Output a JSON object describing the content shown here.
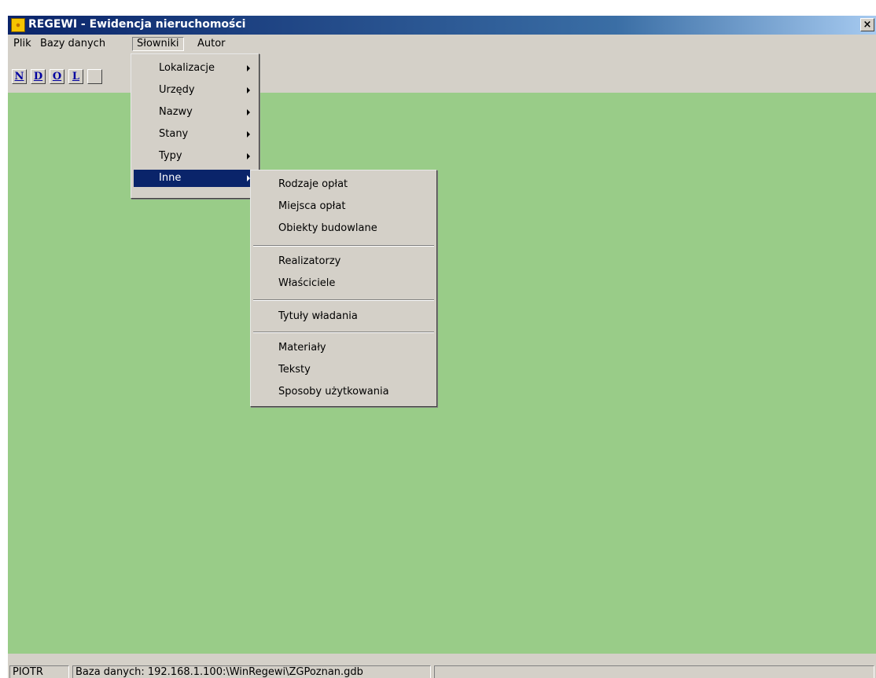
{
  "window": {
    "title": "REGEWI - Ewidencja nieruchomości",
    "close_label": "×"
  },
  "menubar": {
    "items": [
      "Plik",
      "Bazy danych",
      "Słowniki",
      "Autor"
    ]
  },
  "toolbar": {
    "buttons": [
      "N",
      "D",
      "O",
      "L"
    ]
  },
  "slowniki_menu": {
    "items": [
      "Lokalizacje",
      "Urzędy",
      "Nazwy",
      "Stany",
      "Typy",
      "Inne"
    ],
    "selected": "Inne"
  },
  "inne_submenu": {
    "items": [
      "Rodzaje opłat",
      "Miejsca opłat",
      "Obiekty budowlane",
      "Realizatorzy",
      "Właściciele",
      "Tytuły władania",
      "Materiały",
      "Teksty",
      "Sposoby użytkowania"
    ]
  },
  "statusbar": {
    "user": "PIOTR",
    "database": "Baza danych: 192.168.1.100:\\WinRegewi\\ZGPoznan.gdb",
    "extra": ""
  },
  "colors": {
    "titlebar": "#0a246a",
    "client_background": "#99cc88",
    "selection": "#0a246a",
    "face": "#d4d0c8"
  }
}
